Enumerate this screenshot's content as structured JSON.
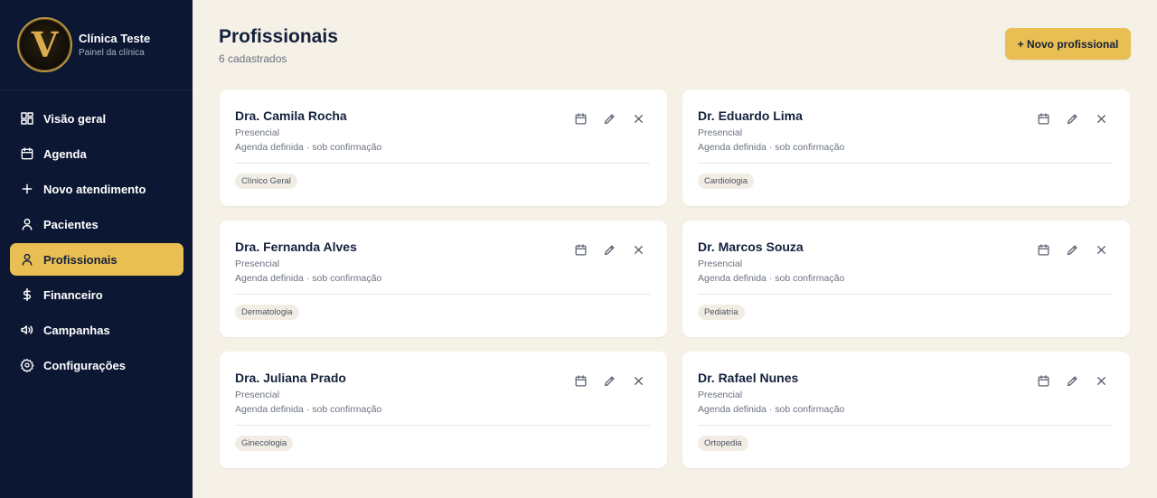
{
  "brand": {
    "logo_letter": "V",
    "title": "Clínica Teste",
    "subtitle": "Painel da clínica"
  },
  "nav": [
    {
      "label": "Visão geral",
      "icon": "dashboard-icon",
      "active": false
    },
    {
      "label": "Agenda",
      "icon": "calendar-icon",
      "active": false
    },
    {
      "label": "Novo atendimento",
      "icon": "plus-icon",
      "active": false
    },
    {
      "label": "Pacientes",
      "icon": "user-icon",
      "active": false
    },
    {
      "label": "Profissionais",
      "icon": "user-icon",
      "active": true
    },
    {
      "label": "Financeiro",
      "icon": "dollar-icon",
      "active": false
    },
    {
      "label": "Campanhas",
      "icon": "megaphone-icon",
      "active": false
    },
    {
      "label": "Configurações",
      "icon": "gear-icon",
      "active": false
    }
  ],
  "page": {
    "title": "Profissionais",
    "subtitle": "6 cadastrados",
    "new_button_label": "+ Novo profissional"
  },
  "professionals": [
    {
      "name": "Dra. Camila Rocha",
      "mode": "Presencial",
      "schedule": "Agenda definida · sob confirmação",
      "specialty": "Clínico Geral"
    },
    {
      "name": "Dr. Eduardo Lima",
      "mode": "Presencial",
      "schedule": "Agenda definida · sob confirmação",
      "specialty": "Cardiologia"
    },
    {
      "name": "Dra. Fernanda Alves",
      "mode": "Presencial",
      "schedule": "Agenda definida · sob confirmação",
      "specialty": "Dermatologia"
    },
    {
      "name": "Dr. Marcos Souza",
      "mode": "Presencial",
      "schedule": "Agenda definida · sob confirmação",
      "specialty": "Pediatria"
    },
    {
      "name": "Dra. Juliana Prado",
      "mode": "Presencial",
      "schedule": "Agenda definida · sob confirmação",
      "specialty": "Ginecologia"
    },
    {
      "name": "Dr. Rafael Nunes",
      "mode": "Presencial",
      "schedule": "Agenda definida · sob confirmação",
      "specialty": "Ortopedia"
    }
  ],
  "colors": {
    "sidebar_bg": "#0b1733",
    "accent": "#e9be52",
    "page_bg": "#f6f1e7",
    "card_bg": "#ffffff",
    "text_dark": "#14213d"
  },
  "card_actions": [
    "calendar-icon",
    "edit-icon",
    "close-icon"
  ]
}
